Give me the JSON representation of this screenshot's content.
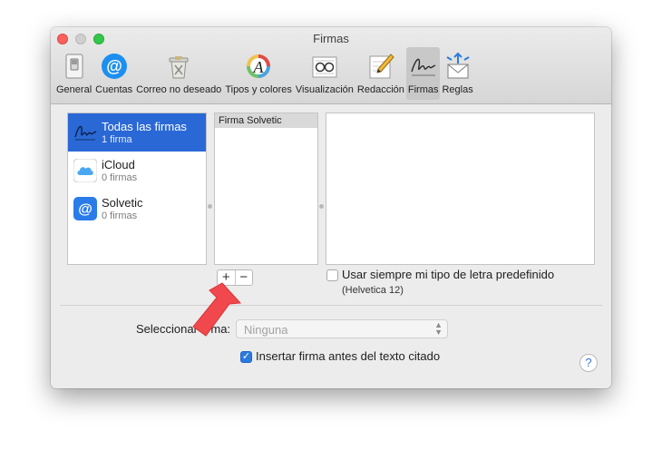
{
  "window": {
    "title": "Firmas"
  },
  "toolbar": {
    "items": [
      {
        "label": "General",
        "icon": "switch-icon"
      },
      {
        "label": "Cuentas",
        "icon": "at-sign-icon"
      },
      {
        "label": "Correo no deseado",
        "icon": "junk-trash-icon"
      },
      {
        "label": "Tipos y colores",
        "icon": "font-color-icon"
      },
      {
        "label": "Visualización",
        "icon": "glasses-icon"
      },
      {
        "label": "Redacción",
        "icon": "pencil-icon"
      },
      {
        "label": "Firmas",
        "icon": "signature-icon",
        "selected": true
      },
      {
        "label": "Reglas",
        "icon": "rules-envelope-icon"
      }
    ]
  },
  "accounts": [
    {
      "name": "Todas las firmas",
      "count": "1 firma",
      "icon": "signature-icon",
      "selected": true
    },
    {
      "name": "iCloud",
      "count": "0 firmas",
      "icon": "icloud-icon"
    },
    {
      "name": "Solvetic",
      "count": "0 firmas",
      "icon": "at-sign-icon"
    }
  ],
  "signatures": [
    {
      "name": "Firma Solvetic"
    }
  ],
  "buttons": {
    "add": "+",
    "remove": "−"
  },
  "font_option": {
    "label": "Usar siempre mi tipo de letra predefinido",
    "font": "(Helvetica 12)",
    "checked": false
  },
  "select_signature": {
    "label": "Seleccionar firma:",
    "value": "Ninguna"
  },
  "insert_before": {
    "label": "Insertar firma antes del texto citado",
    "checked": true,
    "mark": "✓"
  },
  "help": {
    "label": "?"
  },
  "colors": {
    "accent": "#2a68d6",
    "close": "#fc605c",
    "maximize": "#34c84a",
    "arrow": "#f0484c"
  }
}
